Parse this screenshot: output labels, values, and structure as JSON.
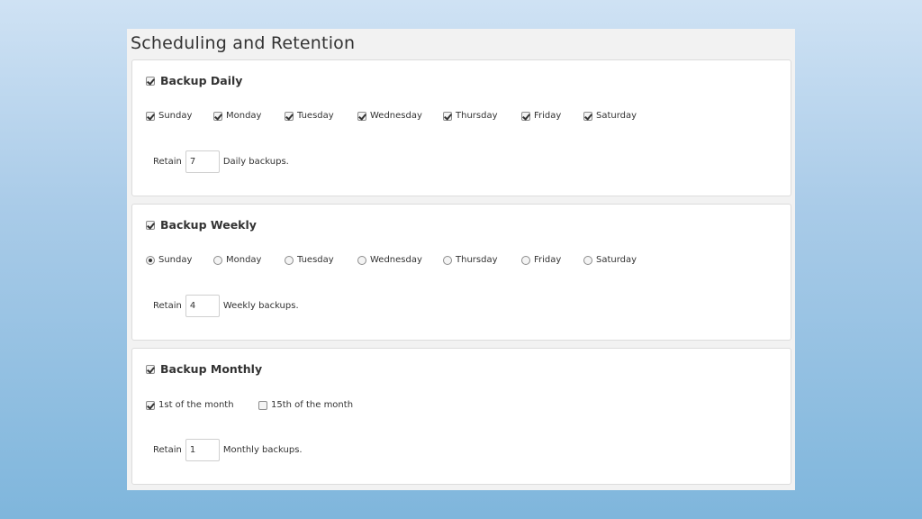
{
  "panel": {
    "title": "Scheduling and Retention"
  },
  "daily": {
    "label": "Backup Daily",
    "enabled": true,
    "days": [
      {
        "label": "Sunday",
        "checked": true
      },
      {
        "label": "Monday",
        "checked": true
      },
      {
        "label": "Tuesday",
        "checked": true
      },
      {
        "label": "Wednesday",
        "checked": true
      },
      {
        "label": "Thursday",
        "checked": true
      },
      {
        "label": "Friday",
        "checked": true
      },
      {
        "label": "Saturday",
        "checked": true
      }
    ],
    "retain_label": "Retain",
    "retain_value": "7",
    "retain_suffix": "Daily backups."
  },
  "weekly": {
    "label": "Backup Weekly",
    "enabled": true,
    "days": [
      {
        "label": "Sunday",
        "selected": true
      },
      {
        "label": "Monday",
        "selected": false
      },
      {
        "label": "Tuesday",
        "selected": false
      },
      {
        "label": "Wednesday",
        "selected": false
      },
      {
        "label": "Thursday",
        "selected": false
      },
      {
        "label": "Friday",
        "selected": false
      },
      {
        "label": "Saturday",
        "selected": false
      }
    ],
    "retain_label": "Retain",
    "retain_value": "4",
    "retain_suffix": "Weekly backups."
  },
  "monthly": {
    "label": "Backup Monthly",
    "enabled": true,
    "options": [
      {
        "label": "1st of the month",
        "checked": true
      },
      {
        "label": "15th of the month",
        "checked": false
      }
    ],
    "retain_label": "Retain",
    "retain_value": "1",
    "retain_suffix": "Monthly backups."
  }
}
